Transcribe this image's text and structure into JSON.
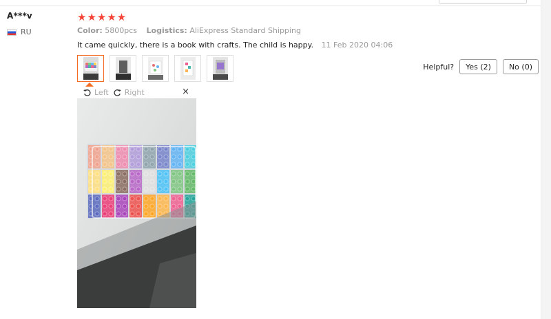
{
  "reviewer": {
    "name": "A***v",
    "country_code": "RU"
  },
  "review": {
    "stars": "★★★★★",
    "rating": 5,
    "color_label": "Color:",
    "color_value": "5800pcs",
    "logistics_label": "Logistics:",
    "logistics_value": "AliExpress Standard Shipping",
    "comment": "It came quickly, there is a book with crafts. The child is happy.",
    "date": "11 Feb 2020 04:06"
  },
  "helpful": {
    "label": "Helpful?",
    "yes": "Yes (2)",
    "no": "No (0)"
  },
  "viewer": {
    "rotate_left": "Left",
    "rotate_right": "Right",
    "close": "×"
  },
  "colors": {
    "star": "#f44336",
    "accent": "#f36c21",
    "muted": "#999999"
  },
  "icons": [
    "rotate-left-icon",
    "rotate-right-icon",
    "close-icon",
    "ru-flag-icon"
  ]
}
